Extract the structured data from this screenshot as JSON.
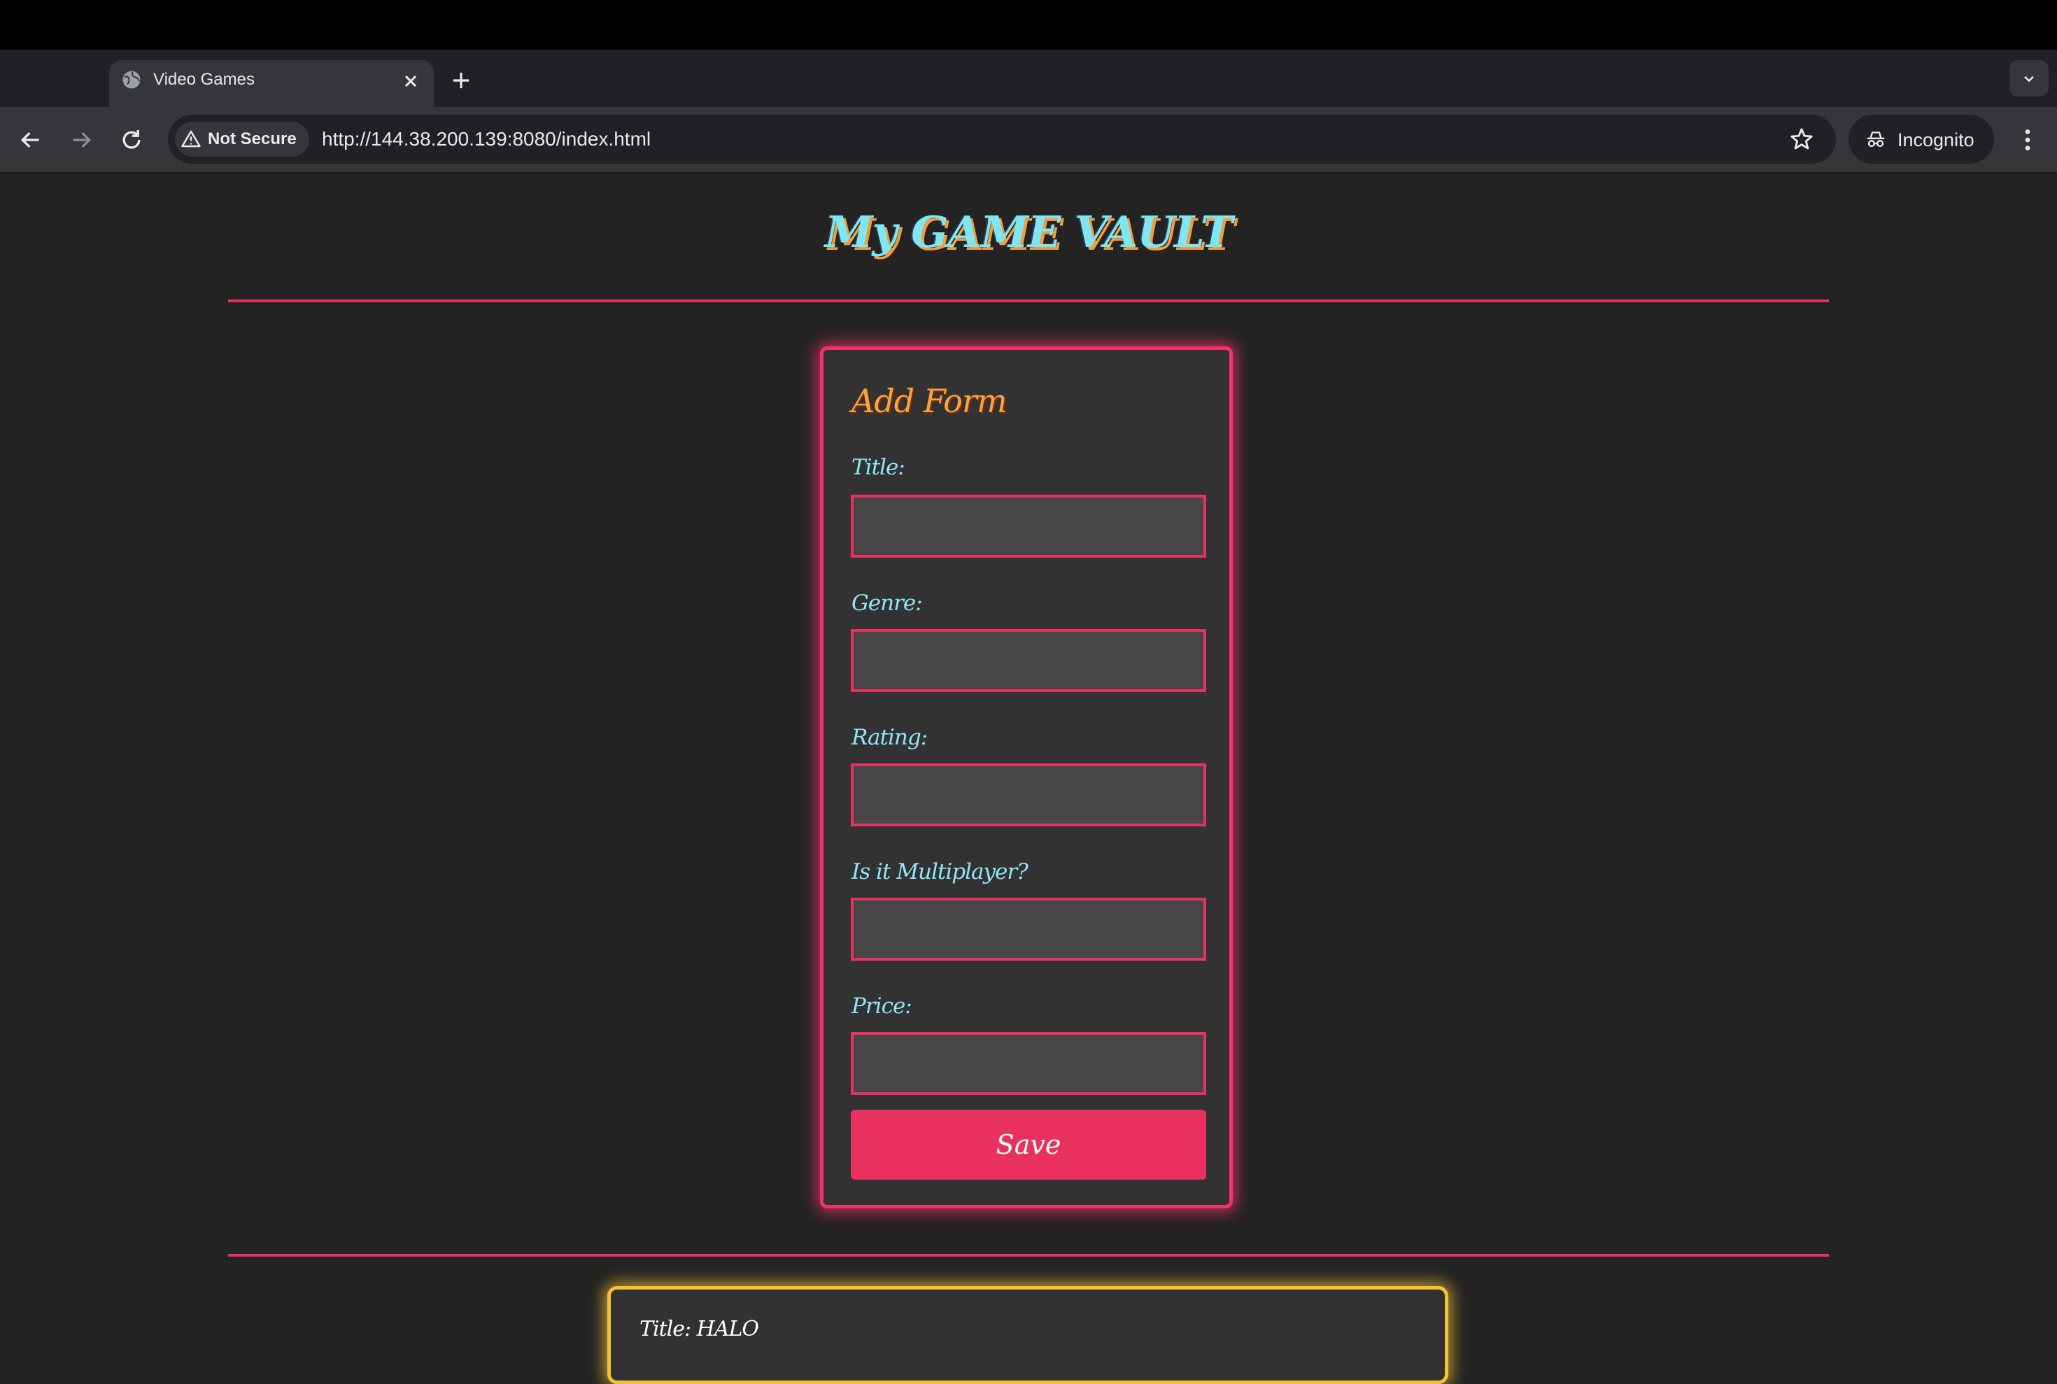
{
  "browser": {
    "tab_title": "Video Games",
    "security_label": "Not Secure",
    "url": "http://144.38.200.139:8080/index.html",
    "incognito_label": "Incognito",
    "icons": [
      "globe-icon",
      "close-icon",
      "plus-icon",
      "chevron-down-icon",
      "back-arrow-icon",
      "forward-arrow-icon",
      "reload-icon",
      "warning-icon",
      "star-icon",
      "incognito-icon",
      "more-vert-icon"
    ]
  },
  "page": {
    "title": "My GAME VAULT",
    "form": {
      "heading": "Add Form",
      "fields": [
        {
          "label": "Title:",
          "value": ""
        },
        {
          "label": "Genre:",
          "value": ""
        },
        {
          "label": "Rating:",
          "value": ""
        },
        {
          "label": "Is it Multiplayer?",
          "value": ""
        },
        {
          "label": "Price:",
          "value": ""
        }
      ],
      "save_label": "Save"
    },
    "games": [
      {
        "title_line": "Title: HALO"
      }
    ],
    "colors": {
      "background": "#232323",
      "accent_pink": "#e8315f",
      "label_cyan": "#8fe7f5",
      "heading_orange": "#f6a441",
      "card_yellow": "#f5c233"
    }
  }
}
